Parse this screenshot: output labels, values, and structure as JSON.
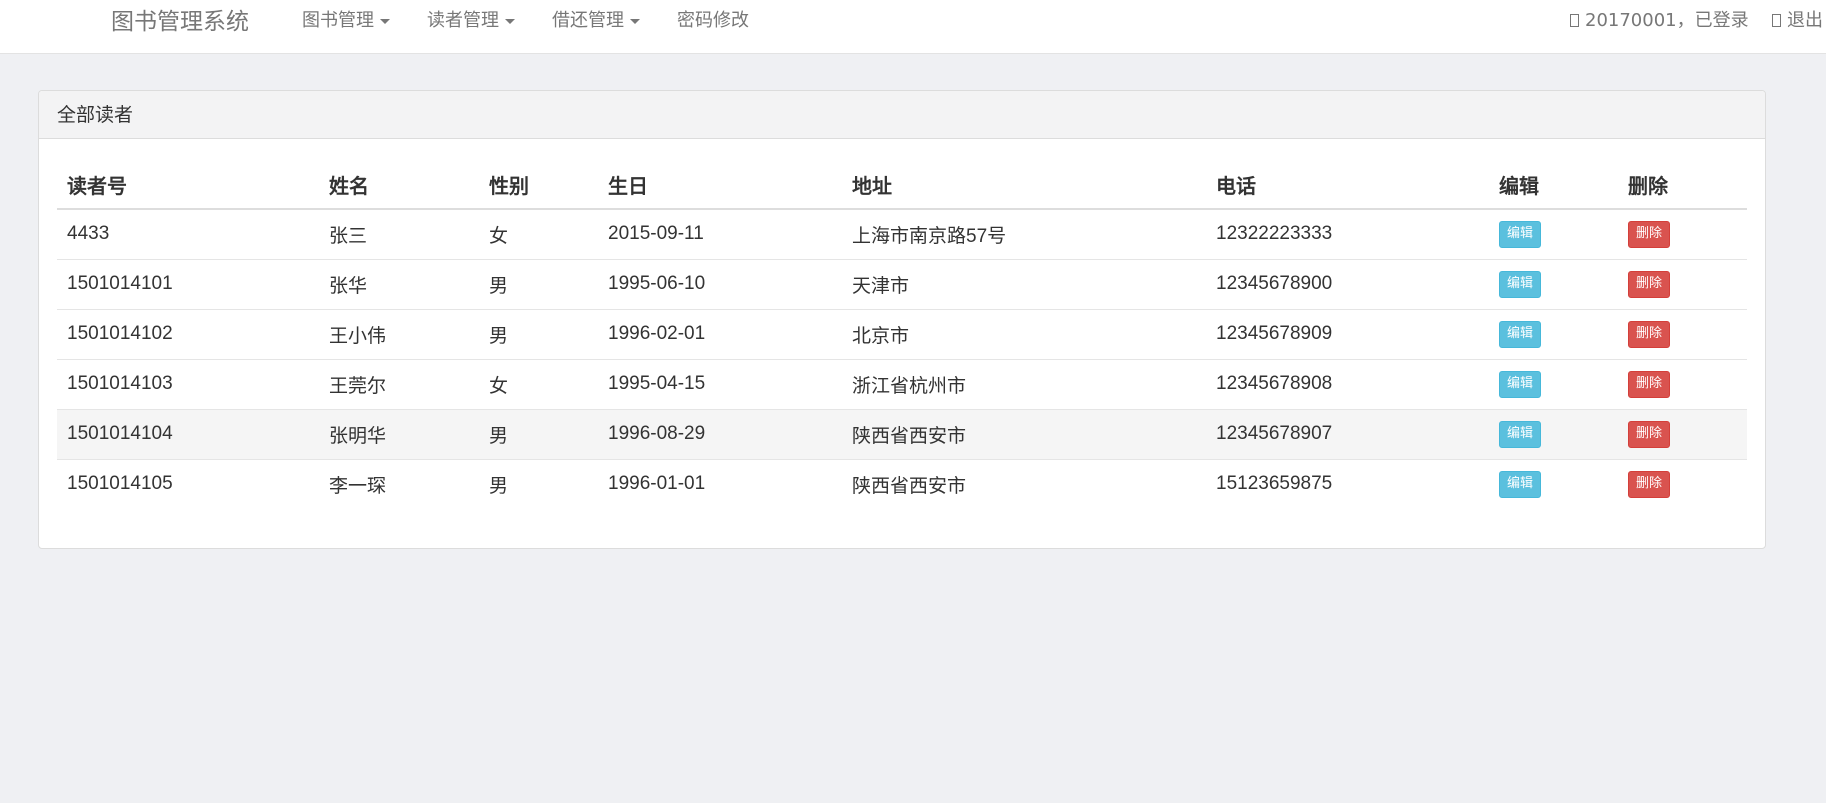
{
  "navbar": {
    "brand": "图书管理系统",
    "menus": [
      "图书管理",
      "读者管理",
      "借还管理",
      "密码修改"
    ],
    "user_status": "20170001，已登录",
    "logout": "退出"
  },
  "panel": {
    "title": "全部读者"
  },
  "table": {
    "headers": [
      "读者号",
      "姓名",
      "性别",
      "生日",
      "地址",
      "电话",
      "编辑",
      "删除"
    ],
    "rows": [
      {
        "id": "4433",
        "name": "张三",
        "gender": "女",
        "birthday": "2015-09-11",
        "address": "上海市南京路57号",
        "phone": "12322223333"
      },
      {
        "id": "1501014101",
        "name": "张华",
        "gender": "男",
        "birthday": "1995-06-10",
        "address": "天津市",
        "phone": "12345678900"
      },
      {
        "id": "1501014102",
        "name": "王小伟",
        "gender": "男",
        "birthday": "1996-02-01",
        "address": "北京市",
        "phone": "12345678909"
      },
      {
        "id": "1501014103",
        "name": "王莞尔",
        "gender": "女",
        "birthday": "1995-04-15",
        "address": "浙江省杭州市",
        "phone": "12345678908"
      },
      {
        "id": "1501014104",
        "name": "张明华",
        "gender": "男",
        "birthday": "1996-08-29",
        "address": "陕西省西安市",
        "phone": "12345678907"
      },
      {
        "id": "1501014105",
        "name": "李一琛",
        "gender": "男",
        "birthday": "1996-01-01",
        "address": "陕西省西安市",
        "phone": "15123659875"
      }
    ],
    "edit_label": "编辑",
    "delete_label": "删除"
  },
  "colors": {
    "edit_button": "#5bc0de",
    "delete_button": "#d9534f",
    "page_background": "#eff0f3"
  }
}
